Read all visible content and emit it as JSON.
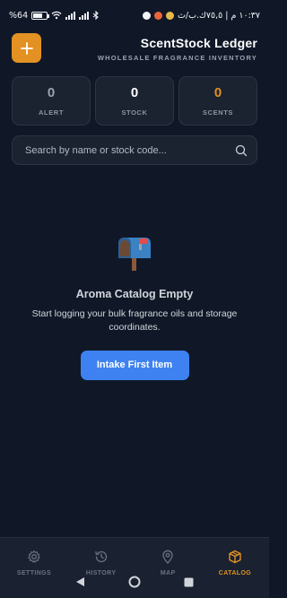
{
  "status_bar": {
    "left_text": "%64",
    "right_text": "١٠:٣٧ م | ٧٥,٥ك.ب/ث"
  },
  "header": {
    "add_icon": "plus-icon",
    "title": "ScentStock Ledger",
    "subtitle": "WHOLESALE FRAGRANCE INVENTORY"
  },
  "stats": [
    {
      "value": "0",
      "label": "ALERT",
      "color": "#9ca3af"
    },
    {
      "value": "0",
      "label": "STOCK",
      "color": "#ffffff"
    },
    {
      "value": "0",
      "label": "SCENTS",
      "color": "#e39122"
    }
  ],
  "search": {
    "placeholder": "Search by name or stock code...",
    "icon": "search-icon"
  },
  "empty_state": {
    "icon": "mailbox-icon",
    "title": "Aroma Catalog Empty",
    "description": "Start logging your bulk fragrance oils and storage coordinates.",
    "button_label": "Intake First Item"
  },
  "nav": [
    {
      "label": "SETTINGS",
      "icon": "gear-icon",
      "active": false
    },
    {
      "label": "HISTORY",
      "icon": "history-icon",
      "active": false
    },
    {
      "label": "MAP",
      "icon": "map-pin-icon",
      "active": false
    },
    {
      "label": "CATALOG",
      "icon": "box-icon",
      "active": true
    }
  ],
  "colors": {
    "background": "#101828",
    "accent": "#e39122",
    "primary_button": "#3d82f0",
    "card": "#1b2331"
  }
}
